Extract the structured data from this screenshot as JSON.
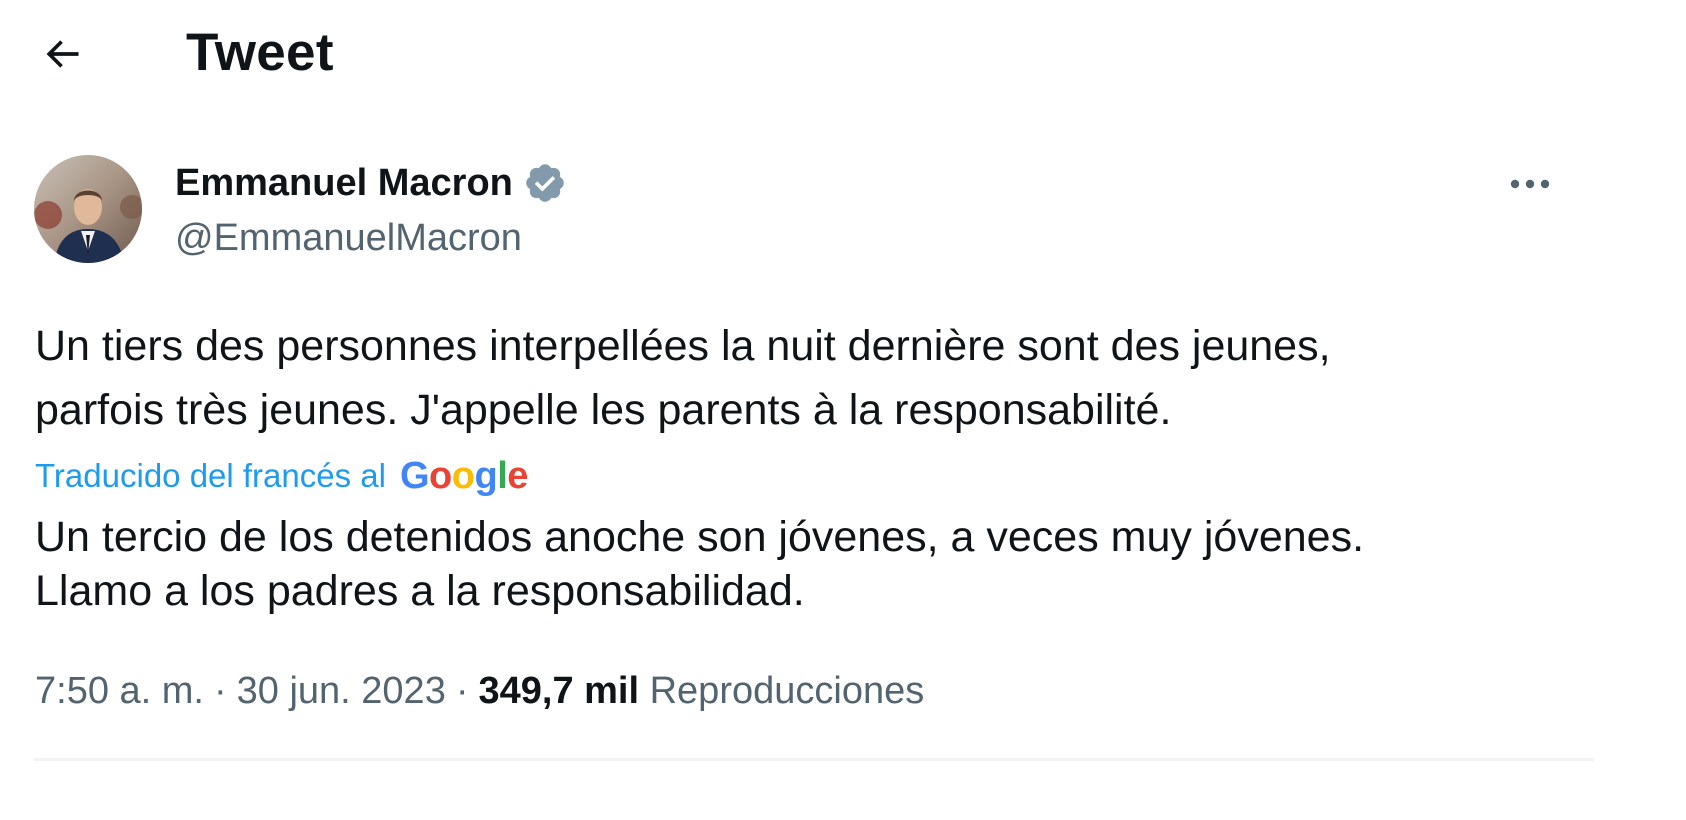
{
  "header": {
    "title": "Tweet",
    "back_icon": "arrow-left-icon"
  },
  "tweet": {
    "author": {
      "display_name": "Emmanuel Macron",
      "handle": "@EmmanuelMacron",
      "verified_icon": "verified-badge-icon",
      "verified_color": "#829aab",
      "avatar_icon": "avatar-photo"
    },
    "more_icon": "more-horizontal-icon",
    "text": {
      "line1": "Un tiers des personnes interpellées la nuit dernière sont des jeunes,",
      "line2": "parfois très jeunes. J'appelle les parents à la responsabilité."
    },
    "translation": {
      "label": "Traducido del francés al",
      "provider": "Google",
      "provider_letters": [
        {
          "char": "G",
          "color": "#4285f4"
        },
        {
          "char": "o",
          "color": "#ea4335"
        },
        {
          "char": "o",
          "color": "#fbbc05"
        },
        {
          "char": "g",
          "color": "#4285f4"
        },
        {
          "char": "l",
          "color": "#34a853"
        },
        {
          "char": "e",
          "color": "#ea4335"
        }
      ],
      "translated_line1": "Un tercio de los detenidos anoche son jóvenes, a veces muy jóvenes.",
      "translated_line2": "Llamo a los padres a la responsabilidad."
    },
    "meta": {
      "time": "7:50 a. m.",
      "separator": "·",
      "date": "30 jun. 2023",
      "views_count": "349,7 mil",
      "views_label": "Reproducciones"
    }
  },
  "colors": {
    "text_primary": "#0f1419",
    "text_secondary": "#536471",
    "link": "#1d9bf0",
    "divider": "#eff3f4"
  }
}
